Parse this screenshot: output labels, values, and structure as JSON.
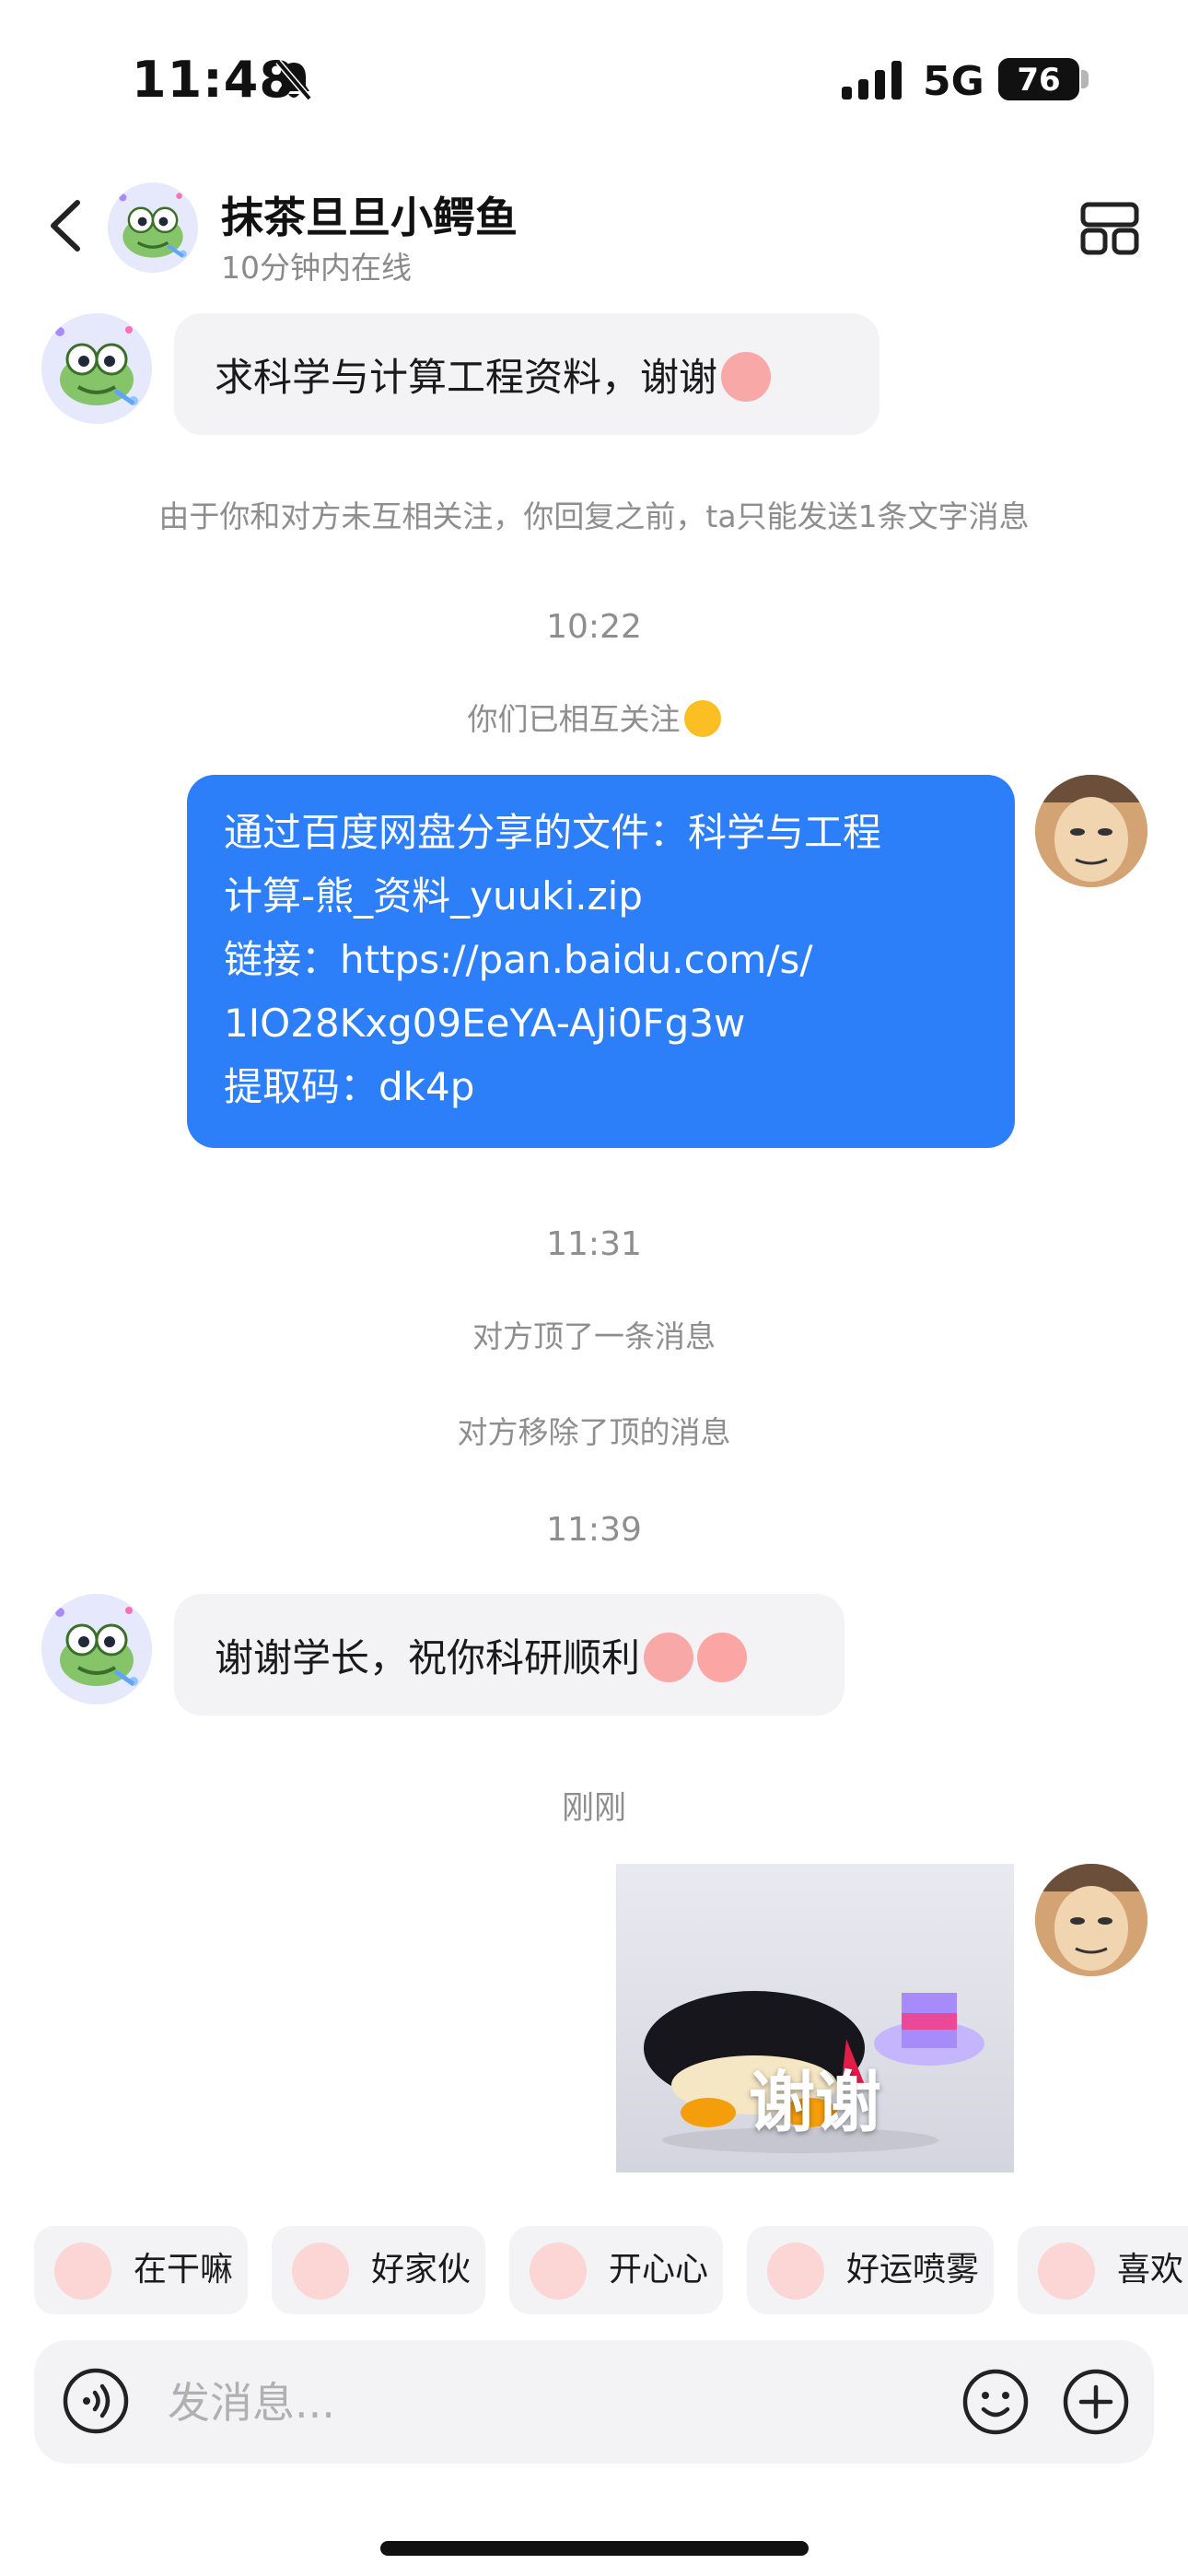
{
  "status_bar": {
    "time": "11:48",
    "network": "5G",
    "battery": "76",
    "battery_level": 0.76
  },
  "header": {
    "name": "抹茶旦旦小鳄鱼",
    "status": "10分钟内在线"
  },
  "messages": {
    "m1": "求科学与计算工程资料，谢谢",
    "notice1": "由于你和对方未互相关注，你回复之前，ta只能发送1条文字消息",
    "time1": "10:22",
    "notice2": "你们已相互关注",
    "share_line1": "通过百度网盘分享的文件：科学与工程",
    "share_line2": "计算-熊_资料_yuuki.zip",
    "share_line3": "链接：https://pan.baidu.com/s/",
    "share_line4": "1IO28Kxg09EeYA-AJi0Fg3w",
    "share_line5": "提取码：dk4p",
    "time2": "11:31",
    "notice3": "对方顶了一条消息",
    "notice4": "对方移除了顶的消息",
    "time3": "11:39",
    "m2": "谢谢学长，祝你科研顺利",
    "time4": "刚刚",
    "sticker_text": "谢谢"
  },
  "quick_replies": [
    "在干嘛",
    "好家伙",
    "开心心",
    "好运喷雾",
    "喜欢"
  ],
  "input": {
    "placeholder": "发消息..."
  },
  "colors": {
    "accent": "#2d7ff9",
    "bubble_in": "#f3f3f5",
    "background": "#ffffff"
  }
}
